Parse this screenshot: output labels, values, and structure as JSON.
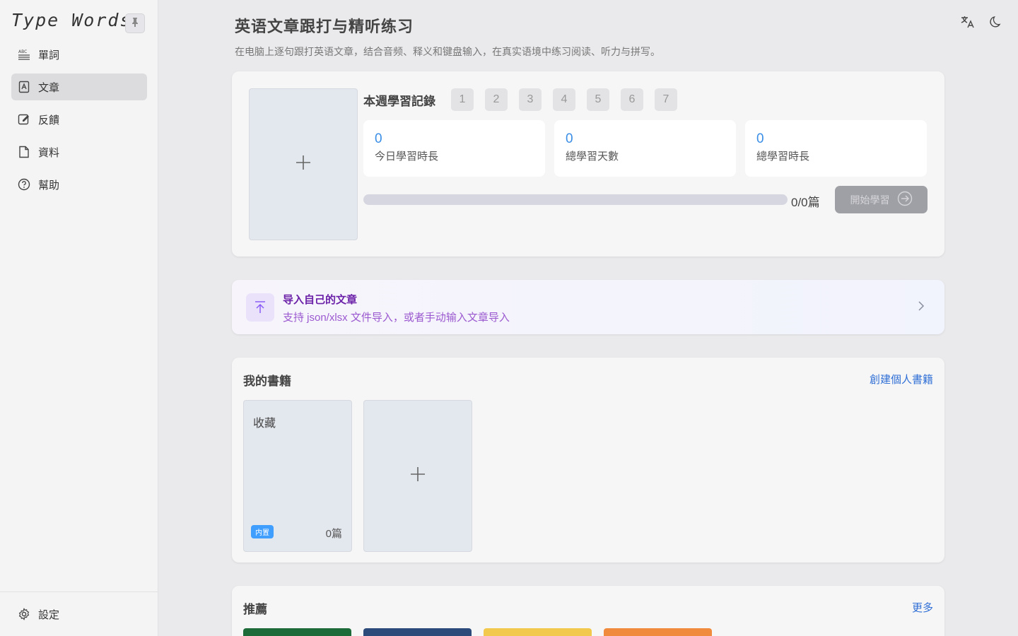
{
  "sidebar": {
    "logo": "Type Words",
    "pin_icon": "pin-icon",
    "items": [
      {
        "label": "單詞",
        "icon": "abc-icon"
      },
      {
        "label": "文章",
        "icon": "article-icon",
        "active": true
      },
      {
        "label": "反饋",
        "icon": "feedback-icon"
      },
      {
        "label": "資料",
        "icon": "document-icon"
      },
      {
        "label": "幫助",
        "icon": "help-icon"
      }
    ],
    "settings_label": "設定"
  },
  "header": {
    "title": "英语文章跟打与精听练习",
    "subtitle": "在电脑上逐句跟打英语文章，结合音频、释义和键盘输入，在真实语境中练习阅读、听力与拼写。"
  },
  "stats": {
    "week_label": "本週學習記錄",
    "days": [
      "1",
      "2",
      "3",
      "4",
      "5",
      "6",
      "7"
    ],
    "boxes": [
      {
        "value": "0",
        "label": "今日學習時長"
      },
      {
        "value": "0",
        "label": "總學習天數"
      },
      {
        "value": "0",
        "label": "總學習時長"
      }
    ],
    "progress_fraction": 0,
    "progress_text": "0/0篇",
    "start_button": "開始學習"
  },
  "import": {
    "title": "导入自己的文章",
    "subtitle": "支持 json/xlsx 文件导入，或者手动输入文章导入"
  },
  "books": {
    "title": "我的書籍",
    "create_link": "創建個人書籍",
    "items": [
      {
        "name": "收藏",
        "badge": "内置",
        "count": "0篇"
      }
    ]
  },
  "recommend": {
    "title": "推薦",
    "more_link": "更多",
    "cover_colors": [
      "#1e6b3a",
      "#2c4a7a",
      "#f2c94c",
      "#f08a3c"
    ]
  },
  "colors": {
    "accent": "#3a8ee6",
    "link": "#2f6fd6",
    "import_title": "#6b21a8",
    "import_sub": "#9b59d0"
  }
}
